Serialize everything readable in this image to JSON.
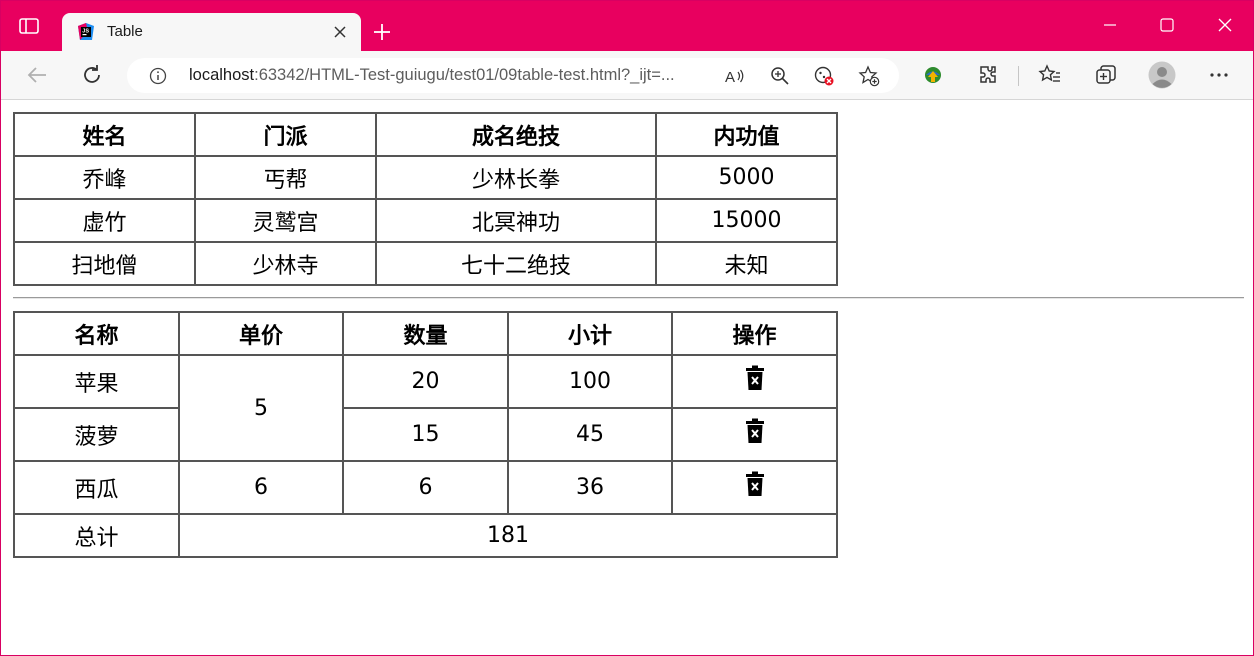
{
  "browser": {
    "tab_title": "Table",
    "url_host": "localhost",
    "url_rest": ":63342/HTML-Test-guiugu/test01/09table-test.html?_ijt=..."
  },
  "table1": {
    "headers": [
      "姓名",
      "门派",
      "成名绝技",
      "内功值"
    ],
    "rows": [
      [
        "乔峰",
        "丐帮",
        "少林长拳",
        "5000"
      ],
      [
        "虚竹",
        "灵鹫宫",
        "北冥神功",
        "15000"
      ],
      [
        "扫地僧",
        "少林寺",
        "七十二绝技",
        "未知"
      ]
    ]
  },
  "table2": {
    "headers": [
      "名称",
      "单价",
      "数量",
      "小计",
      "操作"
    ],
    "rows": [
      {
        "name": "苹果",
        "qty": "20",
        "subtotal": "100"
      },
      {
        "name": "菠萝",
        "qty": "15",
        "subtotal": "45"
      },
      {
        "name": "西瓜",
        "qty": "6",
        "subtotal": "36"
      }
    ],
    "price_shared": "5",
    "price_watermelon": "6",
    "total_label": "总计",
    "total_value": "181",
    "action_icon": "trash-x-icon"
  },
  "colors": {
    "titlebar": "#e8005f",
    "toolbar": "#f7f7f7"
  }
}
